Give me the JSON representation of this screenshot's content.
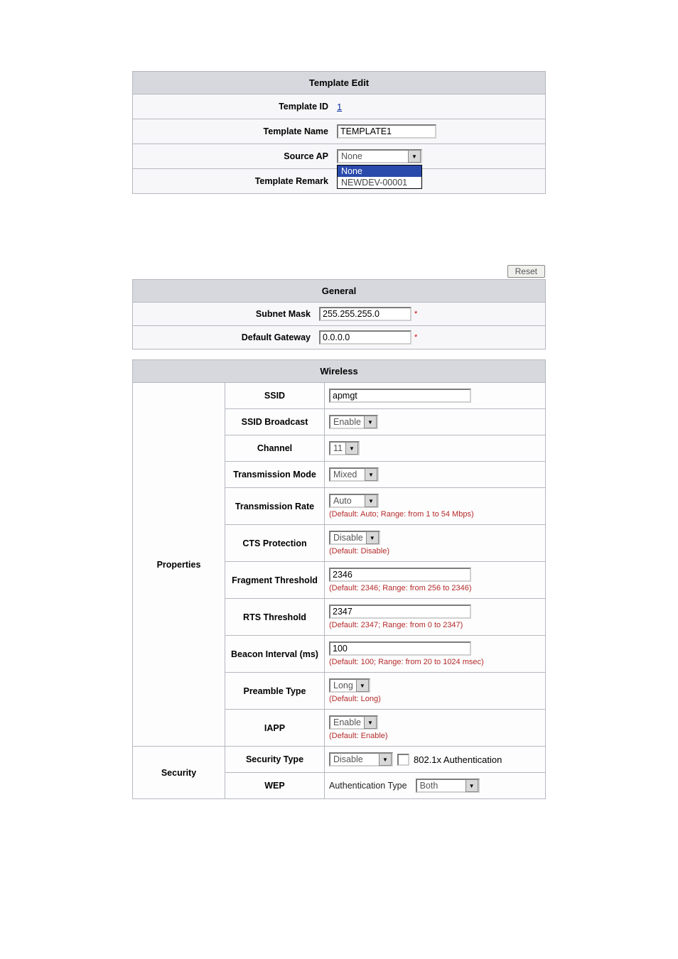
{
  "template_edit": {
    "title": "Template Edit",
    "rows": {
      "template_id": {
        "label": "Template ID",
        "value": "1"
      },
      "template_name": {
        "label": "Template Name",
        "value": "TEMPLATE1"
      },
      "source_ap": {
        "label": "Source AP",
        "value": "None",
        "options": [
          "None",
          "NEWDEV-00001"
        ]
      },
      "template_remark": {
        "label": "Template Remark",
        "value": ""
      }
    }
  },
  "reset_button": "Reset",
  "general": {
    "title": "General",
    "subnet_mask": {
      "label": "Subnet Mask",
      "value": "255.255.255.0"
    },
    "default_gateway": {
      "label": "Default Gateway",
      "value": "0.0.0.0"
    }
  },
  "wireless": {
    "title": "Wireless",
    "groups": {
      "properties": "Properties",
      "security": "Security"
    },
    "ssid": {
      "label": "SSID",
      "value": "apmgt"
    },
    "ssid_broadcast": {
      "label": "SSID Broadcast",
      "value": "Enable"
    },
    "channel": {
      "label": "Channel",
      "value": "11"
    },
    "transmission_mode": {
      "label": "Transmission Mode",
      "value": "Mixed"
    },
    "transmission_rate": {
      "label": "Transmission Rate",
      "value": "Auto",
      "hint": "(Default: Auto; Range: from 1 to 54 Mbps)"
    },
    "cts_protection": {
      "label": "CTS Protection",
      "value": "Disable",
      "hint": "(Default: Disable)"
    },
    "fragment_threshold": {
      "label": "Fragment Threshold",
      "value": "2346",
      "hint": "(Default: 2346; Range: from 256 to 2346)"
    },
    "rts_threshold": {
      "label": "RTS Threshold",
      "value": "2347",
      "hint": "(Default: 2347; Range: from 0 to 2347)"
    },
    "beacon_interval": {
      "label": "Beacon Interval (ms)",
      "value": "100",
      "hint": "(Default: 100; Range: from 20 to 1024 msec)"
    },
    "preamble_type": {
      "label": "Preamble Type",
      "value": "Long",
      "hint": "(Default: Long)"
    },
    "iapp": {
      "label": "IAPP",
      "value": "Enable",
      "hint": "(Default: Enable)"
    },
    "security_type": {
      "label": "Security Type",
      "value": "Disable",
      "checkbox_label": "802.1x Authentication"
    },
    "wep": {
      "label": "WEP",
      "auth_label": "Authentication Type",
      "auth_value": "Both"
    }
  }
}
